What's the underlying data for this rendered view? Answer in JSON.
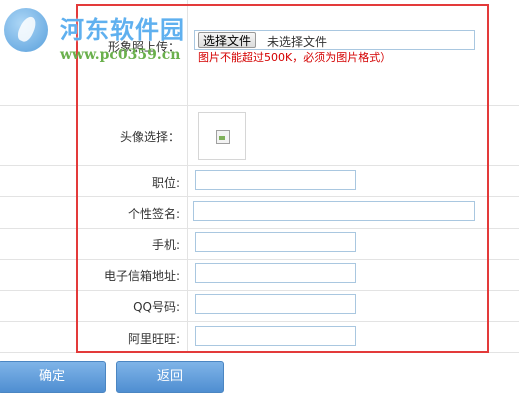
{
  "watermark": {
    "title": "河东软件园",
    "url": "www.pc0359.cn"
  },
  "form": {
    "photo_label": "形象照上传：",
    "file_button": "选择文件",
    "file_status": "未选择文件",
    "photo_hint": "图片不能超过500K，必须为图片格式）",
    "avatar_label": "头像选择：",
    "fields": [
      {
        "label": "职位:",
        "value": "",
        "placeholder": ""
      },
      {
        "label": "个性签名:",
        "value": "",
        "placeholder": ""
      },
      {
        "label": "手机:",
        "value": "",
        "placeholder": ""
      },
      {
        "label": "电子信箱地址:",
        "value": "",
        "placeholder": ""
      },
      {
        "label": "QQ号码:",
        "value": "",
        "placeholder": ""
      },
      {
        "label": "阿里旺旺:",
        "value": "",
        "placeholder": ""
      }
    ]
  },
  "buttons": {
    "confirm": "确定",
    "back": "返回"
  },
  "colors": {
    "highlight_frame": "#e33a3a",
    "hint_text": "#d40000",
    "button_blue": "#5d9ad8",
    "input_border": "#a9c7e0"
  }
}
